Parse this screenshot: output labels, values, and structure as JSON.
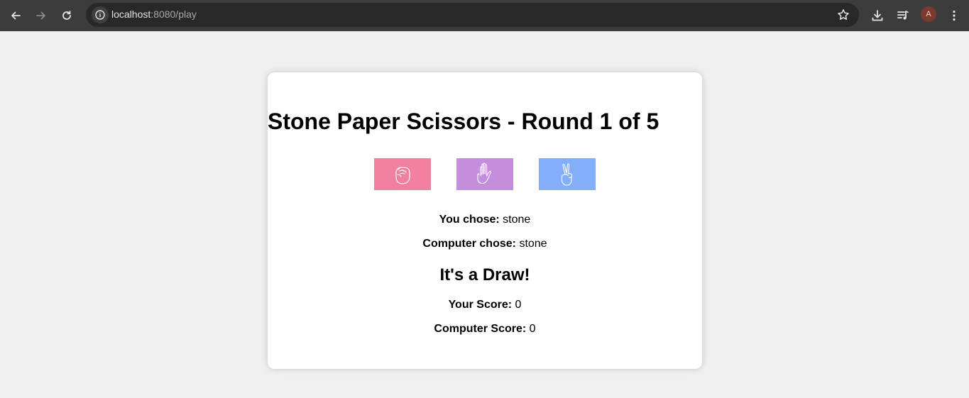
{
  "browser": {
    "url_host": "localhost",
    "url_path": ":8080/play",
    "avatar_letter": "A"
  },
  "game": {
    "title": "Stone Paper Scissors - Round 1 of 5",
    "choices": [
      {
        "name": "stone",
        "icon": "fist-icon",
        "color": "#f07fa0"
      },
      {
        "name": "paper",
        "icon": "open-hand-icon",
        "color": "#c38edb"
      },
      {
        "name": "scissors",
        "icon": "victory-hand-icon",
        "color": "#82aefa"
      }
    ],
    "you_chose_label": "You chose:",
    "you_chose_value": "stone",
    "computer_chose_label": "Computer chose:",
    "computer_chose_value": "stone",
    "result": "It's a Draw!",
    "your_score_label": "Your Score:",
    "your_score_value": "0",
    "computer_score_label": "Computer Score:",
    "computer_score_value": "0"
  }
}
